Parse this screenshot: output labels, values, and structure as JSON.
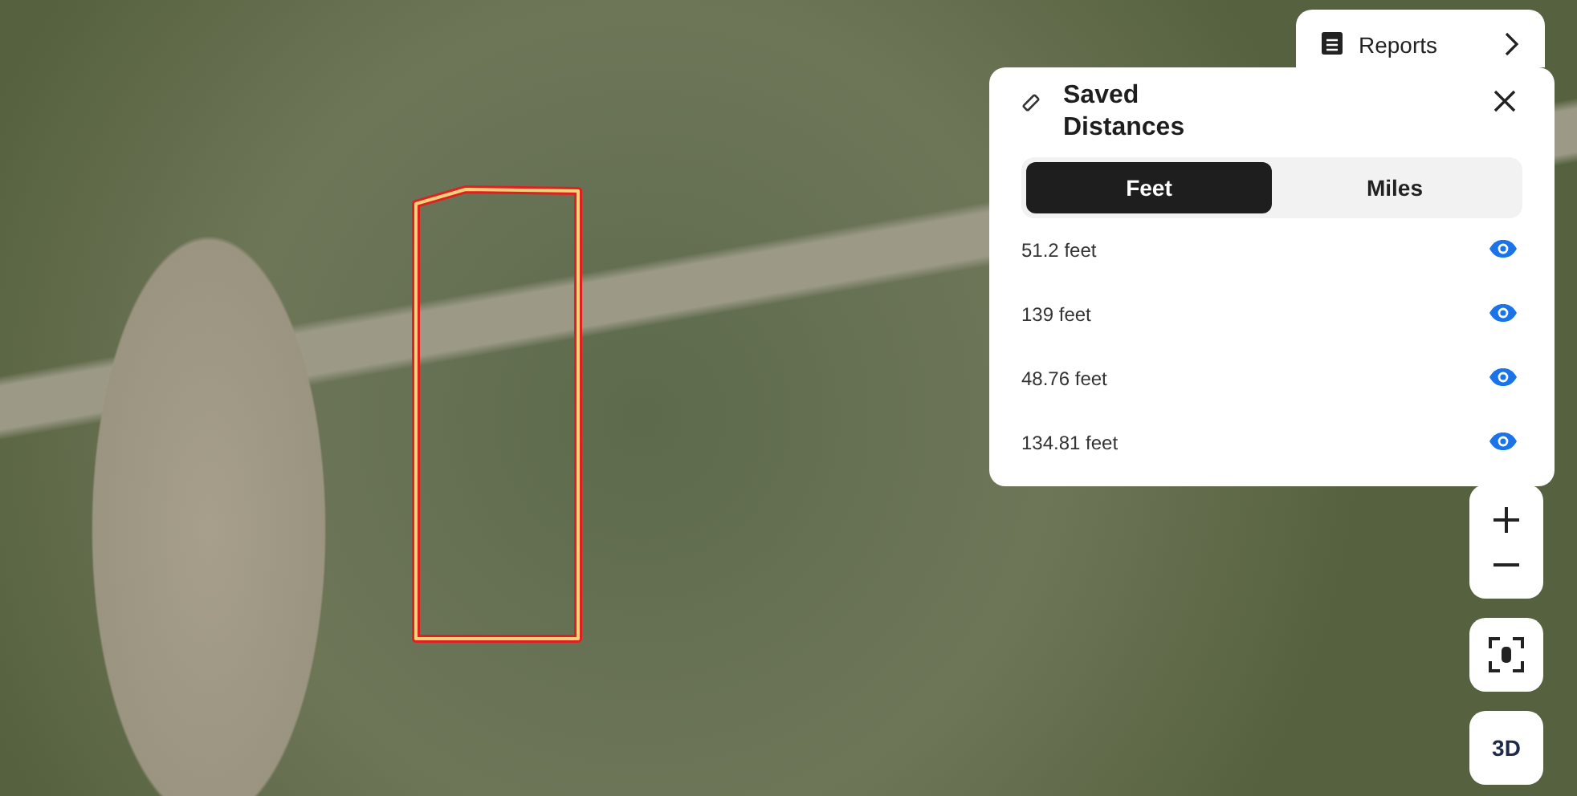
{
  "reports_button": {
    "label": "Reports"
  },
  "panel": {
    "title": "Saved Distances",
    "units": [
      {
        "label": "Feet",
        "selected": true
      },
      {
        "label": "Miles",
        "selected": false
      }
    ],
    "distances": [
      {
        "value": "51.2 feet",
        "visible": true
      },
      {
        "value": "139 feet",
        "visible": true
      },
      {
        "value": "48.76 feet",
        "visible": true
      },
      {
        "value": "134.81 feet",
        "visible": true
      }
    ]
  },
  "view_button": {
    "label": "3D"
  }
}
